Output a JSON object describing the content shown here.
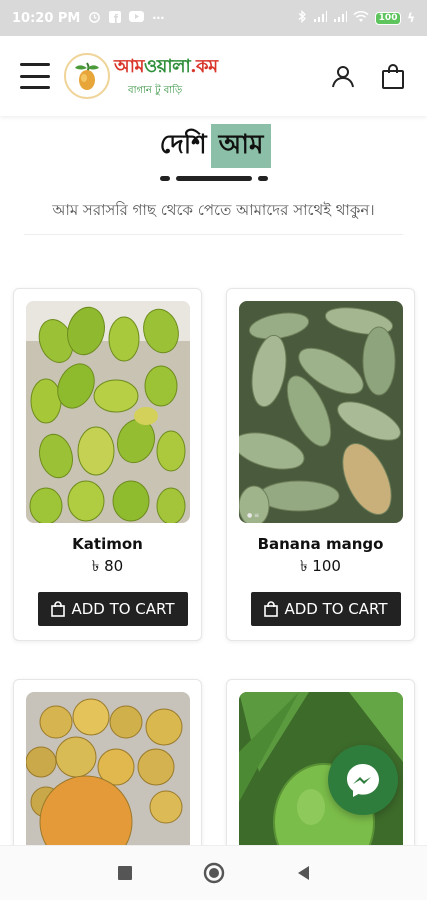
{
  "status_bar": {
    "time": "10:20 PM",
    "battery_level": "100",
    "icons": [
      "alarm-icon",
      "facebook-icon",
      "youtube-icon",
      "more-dots-icon",
      "bluetooth-icon",
      "signal-icon",
      "wifi-icon",
      "battery-icon",
      "charging-icon"
    ]
  },
  "header": {
    "logo_title_part1": "আম",
    "logo_title_part2": "ওয়ালা",
    "logo_title_part3": ".কম",
    "logo_subtitle": "বাগান টু বাড়ি",
    "icons": [
      "menu-icon",
      "user-icon",
      "shopping-bag-icon"
    ]
  },
  "section": {
    "title_plain": "দেশি",
    "title_highlight": "আম",
    "description": "আম সরাসরি গাছ থেকে পেতে আমাদের সাথেই থাকুন।",
    "highlight_color": "#8bbfa7"
  },
  "products": [
    {
      "name": "Katimon",
      "price": "৳ 80",
      "button_label": "ADD TO CART"
    },
    {
      "name": "Banana mango",
      "price": "৳ 100",
      "button_label": "ADD TO CART"
    }
  ],
  "colors": {
    "button": "#222222",
    "messenger": "#2f7d3c",
    "logo_red": "#d9362b",
    "logo_green": "#2f8f3a"
  }
}
